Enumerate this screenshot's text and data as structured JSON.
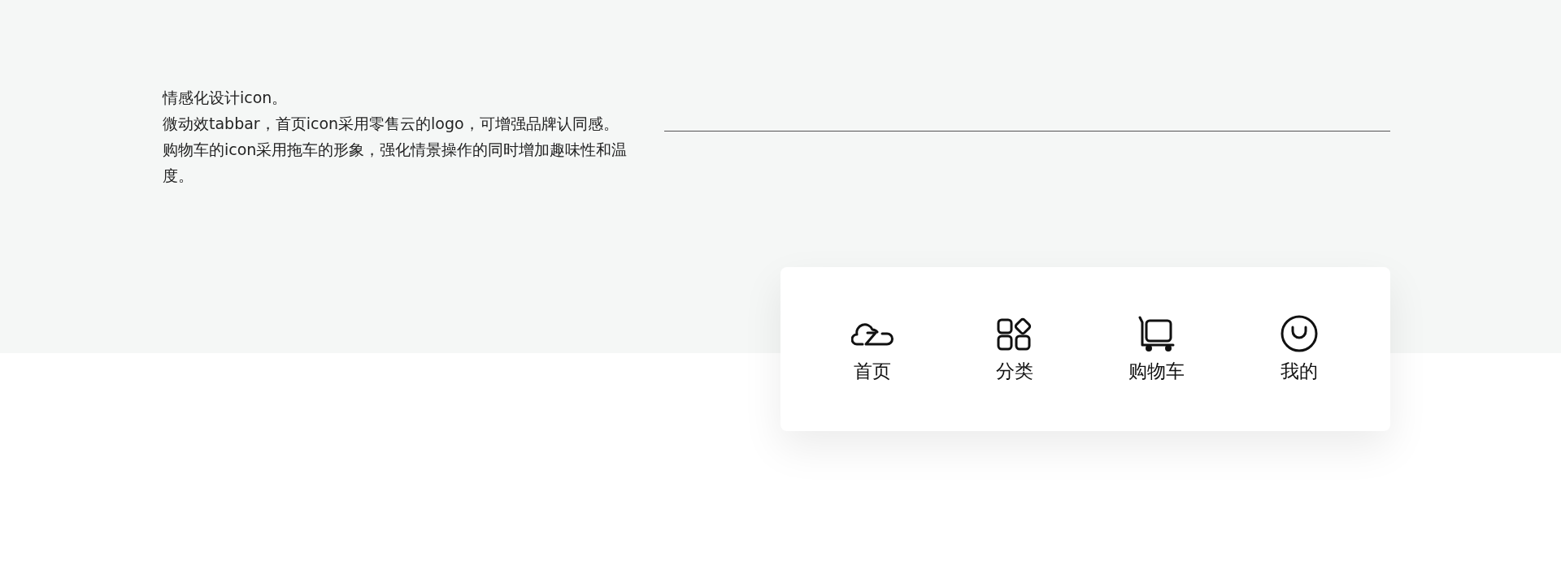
{
  "description": [
    "情感化设计icon。",
    "微动效tabbar，首页icon采用零售云的logo，可增强品牌认同感。",
    "购物车的icon采用拖车的形象，强化情景操作的同时增加趣味性和温度。"
  ],
  "tabbar": {
    "items": [
      {
        "label": "首页"
      },
      {
        "label": "分类"
      },
      {
        "label": "购物车"
      },
      {
        "label": "我的"
      }
    ]
  }
}
